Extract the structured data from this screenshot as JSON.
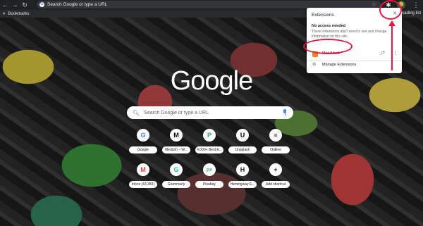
{
  "toolbar": {
    "omnibox_text": "Search Google or type a URL",
    "back_icon": "arrow-left-icon",
    "forward_icon": "arrow-right-icon",
    "reload_icon": "reload-icon"
  },
  "bookmarks": {
    "label": "Bookmarks",
    "reading_list": "Reading list"
  },
  "page": {
    "logo": "Google",
    "search_placeholder": "Search Google or type a URL"
  },
  "shortcuts": [
    {
      "label": "Google",
      "glyph": "G",
      "color": "#4285f4"
    },
    {
      "label": "Medium – W...",
      "glyph": "M",
      "color": "#000000"
    },
    {
      "label": "4,000+ Best E...",
      "glyph": "P",
      "color": "#34a853"
    },
    {
      "label": "Unsplash",
      "glyph": "U",
      "color": "#000000"
    },
    {
      "label": "Outline",
      "glyph": "≡",
      "color": "#202124"
    },
    {
      "label": "Inbox (43,383)",
      "glyph": "M",
      "color": "#ea4335"
    },
    {
      "label": "Grammarly",
      "glyph": "G",
      "color": "#15c39a"
    },
    {
      "label": "Pixabay",
      "glyph": "px",
      "color": "#2ec66d"
    },
    {
      "label": "Hemingway E...",
      "glyph": "H",
      "color": "#202124"
    },
    {
      "label": "Add shortcut",
      "glyph": "+",
      "color": "#202124"
    }
  ],
  "extensions_popup": {
    "title": "Extensions",
    "heading": "No access needed",
    "description": "These extensions don't need to see and change information on this site.",
    "extension_name": "MetaMask",
    "manage_label": "Manage Extensions"
  },
  "colors": {
    "annotation": "#e8173f",
    "chrome_bg": "#202124"
  }
}
